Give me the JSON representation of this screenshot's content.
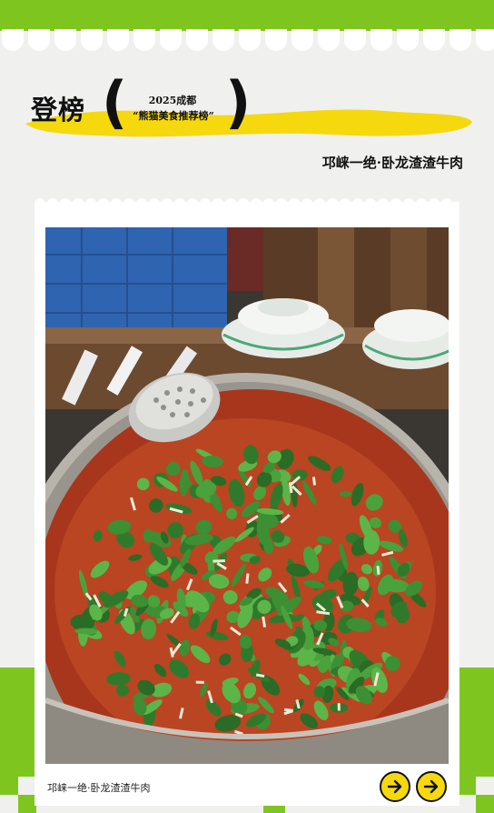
{
  "header": {
    "headline": "登榜",
    "event_year": "2025成都",
    "event_name": "“熊猫美食推荐榜”",
    "subtitle": "邛崃一绝·卧龙渣渣牛肉"
  },
  "card": {
    "caption": "邛崃一绝·卧龙渣渣牛肉",
    "photo_icon": "hotpot-beef-photo",
    "nav_icons": [
      "arrow-right-icon",
      "arrow-right-icon"
    ]
  },
  "colors": {
    "accent_green": "#7ec61f",
    "highlight_yellow": "#f5d90e",
    "background": "#f0f0ee"
  }
}
